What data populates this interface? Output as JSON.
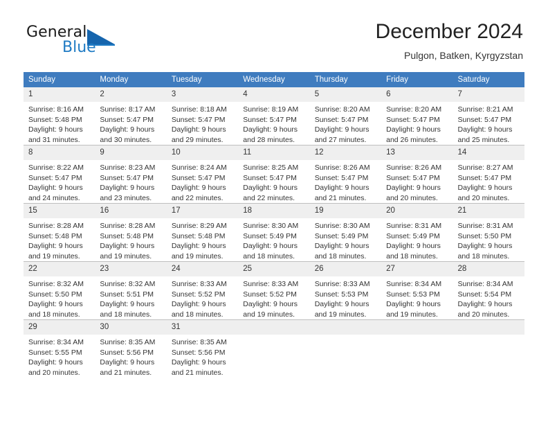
{
  "branding": {
    "name_part1": "General",
    "name_part2": "Blue",
    "logo_icon": "triangle-flag-icon"
  },
  "header": {
    "title": "December 2024",
    "subtitle": "Pulgon, Batken, Kyrgyzstan"
  },
  "calendar": {
    "weekday_headers": [
      "Sunday",
      "Monday",
      "Tuesday",
      "Wednesday",
      "Thursday",
      "Friday",
      "Saturday"
    ],
    "header_bg": "#3f7cbf",
    "daynum_bg": "#efefef",
    "weeks": [
      [
        {
          "day": "1",
          "lines": [
            "Sunrise: 8:16 AM",
            "Sunset: 5:48 PM",
            "Daylight: 9 hours",
            "and 31 minutes."
          ]
        },
        {
          "day": "2",
          "lines": [
            "Sunrise: 8:17 AM",
            "Sunset: 5:47 PM",
            "Daylight: 9 hours",
            "and 30 minutes."
          ]
        },
        {
          "day": "3",
          "lines": [
            "Sunrise: 8:18 AM",
            "Sunset: 5:47 PM",
            "Daylight: 9 hours",
            "and 29 minutes."
          ]
        },
        {
          "day": "4",
          "lines": [
            "Sunrise: 8:19 AM",
            "Sunset: 5:47 PM",
            "Daylight: 9 hours",
            "and 28 minutes."
          ]
        },
        {
          "day": "5",
          "lines": [
            "Sunrise: 8:20 AM",
            "Sunset: 5:47 PM",
            "Daylight: 9 hours",
            "and 27 minutes."
          ]
        },
        {
          "day": "6",
          "lines": [
            "Sunrise: 8:20 AM",
            "Sunset: 5:47 PM",
            "Daylight: 9 hours",
            "and 26 minutes."
          ]
        },
        {
          "day": "7",
          "lines": [
            "Sunrise: 8:21 AM",
            "Sunset: 5:47 PM",
            "Daylight: 9 hours",
            "and 25 minutes."
          ]
        }
      ],
      [
        {
          "day": "8",
          "lines": [
            "Sunrise: 8:22 AM",
            "Sunset: 5:47 PM",
            "Daylight: 9 hours",
            "and 24 minutes."
          ]
        },
        {
          "day": "9",
          "lines": [
            "Sunrise: 8:23 AM",
            "Sunset: 5:47 PM",
            "Daylight: 9 hours",
            "and 23 minutes."
          ]
        },
        {
          "day": "10",
          "lines": [
            "Sunrise: 8:24 AM",
            "Sunset: 5:47 PM",
            "Daylight: 9 hours",
            "and 22 minutes."
          ]
        },
        {
          "day": "11",
          "lines": [
            "Sunrise: 8:25 AM",
            "Sunset: 5:47 PM",
            "Daylight: 9 hours",
            "and 22 minutes."
          ]
        },
        {
          "day": "12",
          "lines": [
            "Sunrise: 8:26 AM",
            "Sunset: 5:47 PM",
            "Daylight: 9 hours",
            "and 21 minutes."
          ]
        },
        {
          "day": "13",
          "lines": [
            "Sunrise: 8:26 AM",
            "Sunset: 5:47 PM",
            "Daylight: 9 hours",
            "and 20 minutes."
          ]
        },
        {
          "day": "14",
          "lines": [
            "Sunrise: 8:27 AM",
            "Sunset: 5:47 PM",
            "Daylight: 9 hours",
            "and 20 minutes."
          ]
        }
      ],
      [
        {
          "day": "15",
          "lines": [
            "Sunrise: 8:28 AM",
            "Sunset: 5:48 PM",
            "Daylight: 9 hours",
            "and 19 minutes."
          ]
        },
        {
          "day": "16",
          "lines": [
            "Sunrise: 8:28 AM",
            "Sunset: 5:48 PM",
            "Daylight: 9 hours",
            "and 19 minutes."
          ]
        },
        {
          "day": "17",
          "lines": [
            "Sunrise: 8:29 AM",
            "Sunset: 5:48 PM",
            "Daylight: 9 hours",
            "and 19 minutes."
          ]
        },
        {
          "day": "18",
          "lines": [
            "Sunrise: 8:30 AM",
            "Sunset: 5:49 PM",
            "Daylight: 9 hours",
            "and 18 minutes."
          ]
        },
        {
          "day": "19",
          "lines": [
            "Sunrise: 8:30 AM",
            "Sunset: 5:49 PM",
            "Daylight: 9 hours",
            "and 18 minutes."
          ]
        },
        {
          "day": "20",
          "lines": [
            "Sunrise: 8:31 AM",
            "Sunset: 5:49 PM",
            "Daylight: 9 hours",
            "and 18 minutes."
          ]
        },
        {
          "day": "21",
          "lines": [
            "Sunrise: 8:31 AM",
            "Sunset: 5:50 PM",
            "Daylight: 9 hours",
            "and 18 minutes."
          ]
        }
      ],
      [
        {
          "day": "22",
          "lines": [
            "Sunrise: 8:32 AM",
            "Sunset: 5:50 PM",
            "Daylight: 9 hours",
            "and 18 minutes."
          ]
        },
        {
          "day": "23",
          "lines": [
            "Sunrise: 8:32 AM",
            "Sunset: 5:51 PM",
            "Daylight: 9 hours",
            "and 18 minutes."
          ]
        },
        {
          "day": "24",
          "lines": [
            "Sunrise: 8:33 AM",
            "Sunset: 5:52 PM",
            "Daylight: 9 hours",
            "and 18 minutes."
          ]
        },
        {
          "day": "25",
          "lines": [
            "Sunrise: 8:33 AM",
            "Sunset: 5:52 PM",
            "Daylight: 9 hours",
            "and 19 minutes."
          ]
        },
        {
          "day": "26",
          "lines": [
            "Sunrise: 8:33 AM",
            "Sunset: 5:53 PM",
            "Daylight: 9 hours",
            "and 19 minutes."
          ]
        },
        {
          "day": "27",
          "lines": [
            "Sunrise: 8:34 AM",
            "Sunset: 5:53 PM",
            "Daylight: 9 hours",
            "and 19 minutes."
          ]
        },
        {
          "day": "28",
          "lines": [
            "Sunrise: 8:34 AM",
            "Sunset: 5:54 PM",
            "Daylight: 9 hours",
            "and 20 minutes."
          ]
        }
      ],
      [
        {
          "day": "29",
          "lines": [
            "Sunrise: 8:34 AM",
            "Sunset: 5:55 PM",
            "Daylight: 9 hours",
            "and 20 minutes."
          ]
        },
        {
          "day": "30",
          "lines": [
            "Sunrise: 8:35 AM",
            "Sunset: 5:56 PM",
            "Daylight: 9 hours",
            "and 21 minutes."
          ]
        },
        {
          "day": "31",
          "lines": [
            "Sunrise: 8:35 AM",
            "Sunset: 5:56 PM",
            "Daylight: 9 hours",
            "and 21 minutes."
          ]
        },
        {
          "day": "",
          "lines": []
        },
        {
          "day": "",
          "lines": []
        },
        {
          "day": "",
          "lines": []
        },
        {
          "day": "",
          "lines": []
        }
      ]
    ]
  }
}
